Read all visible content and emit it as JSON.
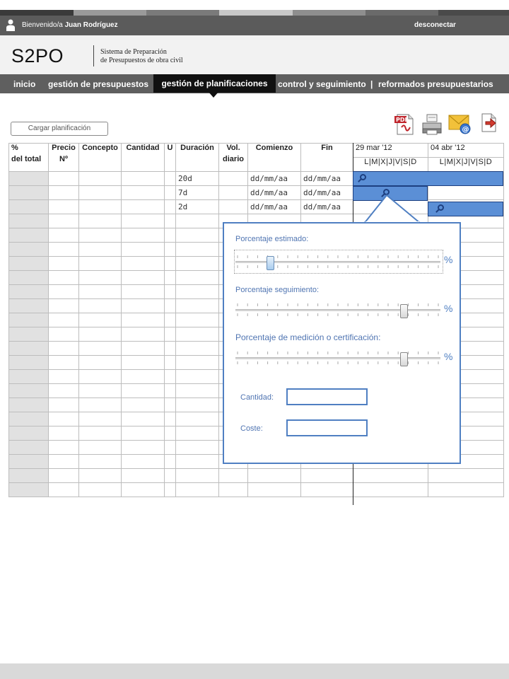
{
  "colors": {
    "accent": "#4f7fc2",
    "bar": "#5b8fd6",
    "dark": "#111111",
    "nav": "#5f5f5f"
  },
  "user": {
    "welcome": "Bienvenido/a",
    "name": "Juan Rodríguez",
    "logout": "desconectar"
  },
  "brand": {
    "logo": "S2PO",
    "line1": "Sistema de Preparación",
    "line2": "de Presupuestos de obra civil"
  },
  "nav": {
    "inicio": "inicio",
    "presupuestos": "gestión de presupuestos",
    "planificaciones": "gestión de planificaciones",
    "control": "control y seguimiento",
    "separator": "|",
    "reformados": "reformados presupuestarios"
  },
  "toolbar": {
    "load": "Cargar planificación",
    "icons": [
      "pdf-icon",
      "printer-icon",
      "email-icon",
      "export-icon"
    ]
  },
  "table": {
    "headers": {
      "pct": "%",
      "pct2": "del total",
      "precio": "Precio",
      "precio2": "Nº",
      "concepto": "Concepto",
      "cantidad": "Cantidad",
      "u": "U",
      "duracion": "Duración",
      "vol": "Vol.",
      "vol2": "diario",
      "comienzo": "Comienzo",
      "fin": "Fin",
      "week1": "29 mar '12",
      "week2": "04 abr '12",
      "days1": "L|M|X|J|V|S|D",
      "days2": "L|M|X|J|V|S|D"
    },
    "rows": [
      {
        "duracion": "20d",
        "comienzo": "dd/mm/aa",
        "fin": "dd/mm/aa"
      },
      {
        "duracion": "7d",
        "comienzo": "dd/mm/aa",
        "fin": "dd/mm/aa"
      },
      {
        "duracion": "2d",
        "comienzo": "dd/mm/aa",
        "fin": "dd/mm/aa"
      }
    ]
  },
  "popup": {
    "estimado_label": "Porcentaje estimado:",
    "seguimiento_label": "Porcentaje seguimiento:",
    "medicion_label": "Porcentaje de medición o certificación:",
    "percent_sign": "%",
    "estimado_value": 0.17,
    "seguimiento_value": 0.82,
    "medicion_value": 0.82,
    "cantidad_label": "Cantidad:",
    "coste_label": "Coste:",
    "cantidad_value": "",
    "coste_value": ""
  }
}
